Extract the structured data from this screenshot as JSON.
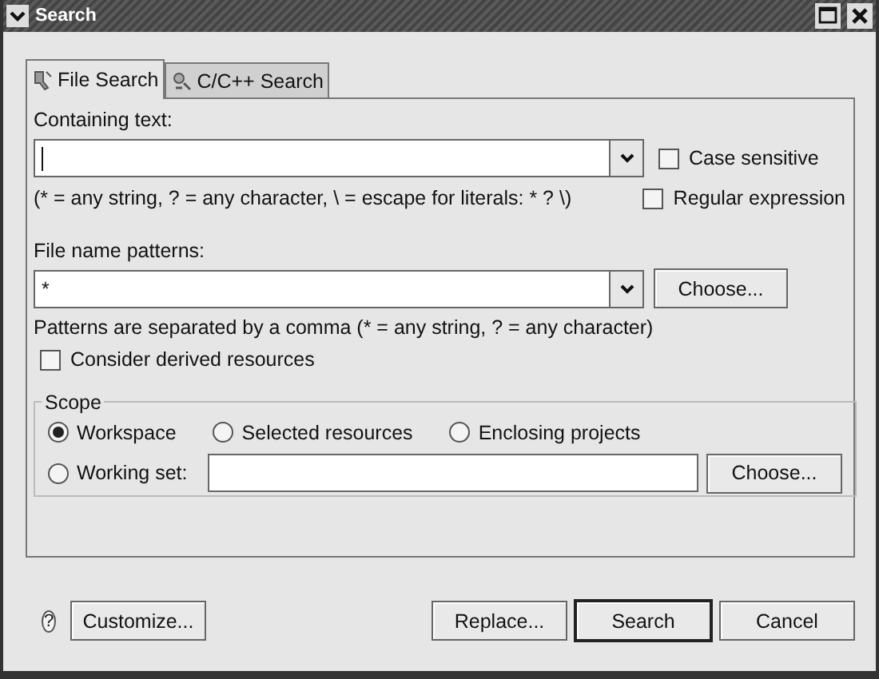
{
  "window": {
    "title": "Search"
  },
  "tabs": [
    {
      "label": "File Search",
      "selected": true
    },
    {
      "label": "C/C++ Search",
      "selected": false
    }
  ],
  "containing_text": {
    "label": "Containing text:",
    "hint": "(* = any string, ? = any character, \\ = escape for literals: * ? \\)"
  },
  "text_options": [
    {
      "label": "Case sensitive",
      "checked": false
    },
    {
      "label": "Regular expression",
      "checked": false
    }
  ],
  "file_name_patterns": {
    "label": "File name patterns:",
    "value": "*",
    "button": "Choose...",
    "hint": "Patterns are separated by a comma (* = any string, ? = any character)"
  },
  "derived_resources": {
    "label": "Consider derived resources",
    "checked": false
  },
  "scope": {
    "title": "Scope",
    "options": [
      {
        "label": "Workspace",
        "selected": true
      },
      {
        "label": "Selected resources",
        "selected": false
      },
      {
        "label": "Enclosing projects",
        "selected": false
      },
      {
        "label": "Working set:",
        "selected": false
      }
    ],
    "button": "Choose..."
  },
  "help": {
    "symbol": "?"
  },
  "buttons": [
    {
      "label": "Customize...",
      "default": false
    },
    {
      "label": "Replace...",
      "default": false
    },
    {
      "label": "Search",
      "default": true
    },
    {
      "label": "Cancel",
      "default": false
    }
  ]
}
